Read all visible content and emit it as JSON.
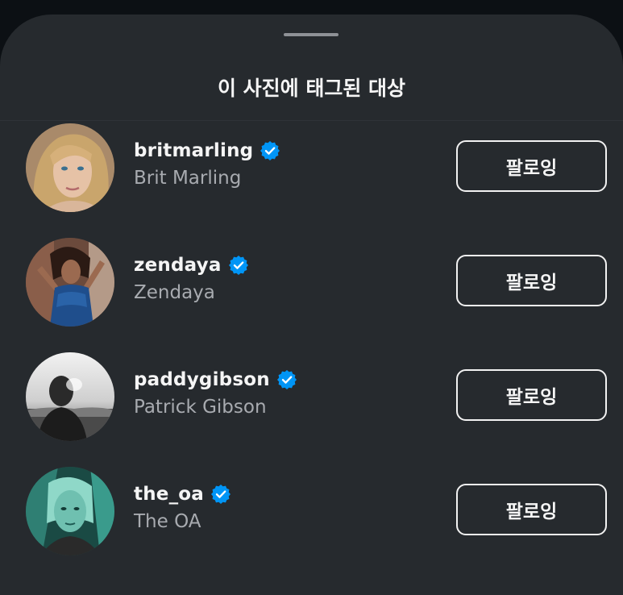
{
  "sheet": {
    "title": "이 사진에 태그된 대상"
  },
  "users": [
    {
      "username": "britmarling",
      "full_name": "Brit Marling",
      "verified": true,
      "follow_label": "팔로잉"
    },
    {
      "username": "zendaya",
      "full_name": "Zendaya",
      "verified": true,
      "follow_label": "팔로잉"
    },
    {
      "username": "paddygibson",
      "full_name": "Patrick Gibson",
      "verified": true,
      "follow_label": "팔로잉"
    },
    {
      "username": "the_oa",
      "full_name": "The OA",
      "verified": true,
      "follow_label": "팔로잉"
    }
  ],
  "icons": {
    "verified": "verified-badge-icon"
  },
  "colors": {
    "sheet_background": "#262a2e",
    "page_background": "#0c1014",
    "verified_blue": "#0095f6",
    "primary_text": "#f5f5f5",
    "secondary_text": "#a8abb0"
  }
}
